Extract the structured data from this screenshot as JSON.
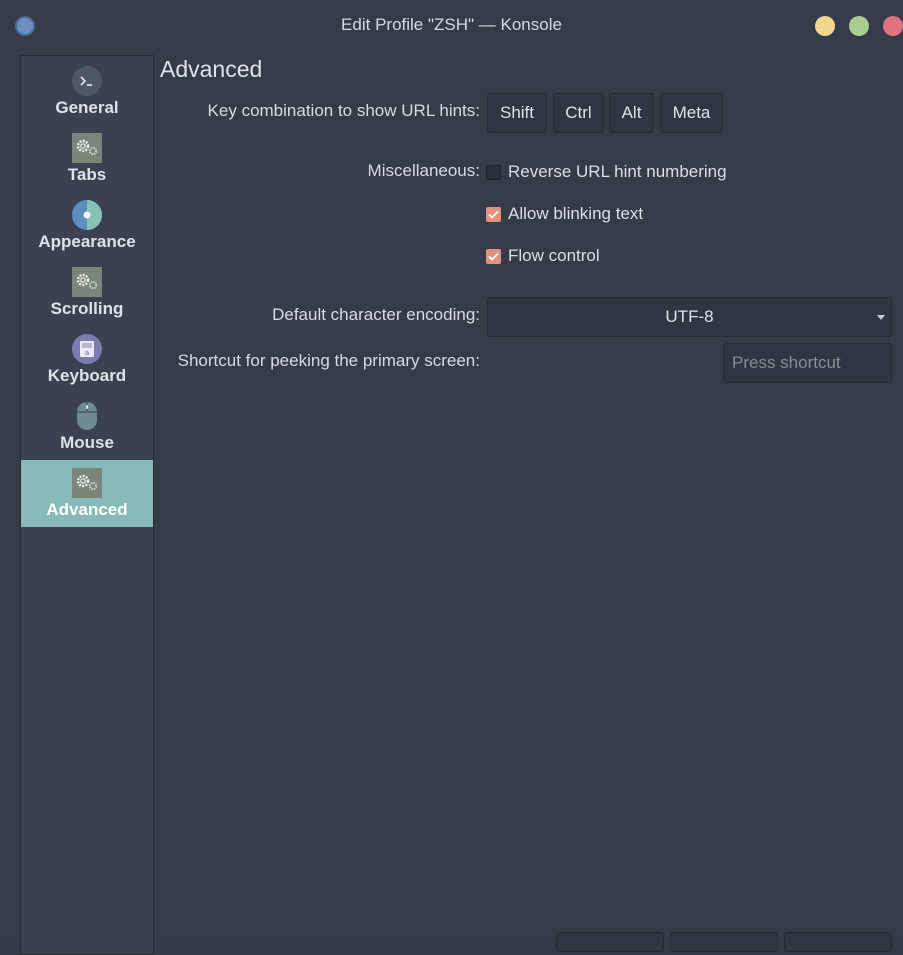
{
  "window": {
    "title": "Edit Profile \"ZSH\" — Konsole"
  },
  "sidebar": {
    "items": [
      {
        "label": "General",
        "icon": "terminal-icon"
      },
      {
        "label": "Tabs",
        "icon": "gears-icon"
      },
      {
        "label": "Appearance",
        "icon": "color-wheel-icon"
      },
      {
        "label": "Scrolling",
        "icon": "gears-icon"
      },
      {
        "label": "Keyboard",
        "icon": "keyboard-icon"
      },
      {
        "label": "Mouse",
        "icon": "mouse-icon"
      },
      {
        "label": "Advanced",
        "icon": "gears-icon",
        "active": true
      }
    ]
  },
  "main": {
    "heading": "Advanced",
    "url_hints": {
      "label": "Key combination to show URL hints:",
      "keys": [
        "Shift",
        "Ctrl",
        "Alt",
        "Meta"
      ]
    },
    "misc": {
      "label": "Miscellaneous:",
      "options": [
        {
          "label": "Reverse URL hint numbering",
          "checked": false
        },
        {
          "label": "Allow blinking text",
          "checked": true
        },
        {
          "label": "Flow control",
          "checked": true
        }
      ]
    },
    "encoding": {
      "label": "Default character encoding:",
      "value": "UTF-8"
    },
    "peek": {
      "label": "Shortcut for peeking the primary screen:",
      "placeholder": "Press shortcut"
    }
  },
  "colors": {
    "accent": "#88b9b9",
    "checkbox_on": "#e2917a",
    "background": "#353b49"
  }
}
